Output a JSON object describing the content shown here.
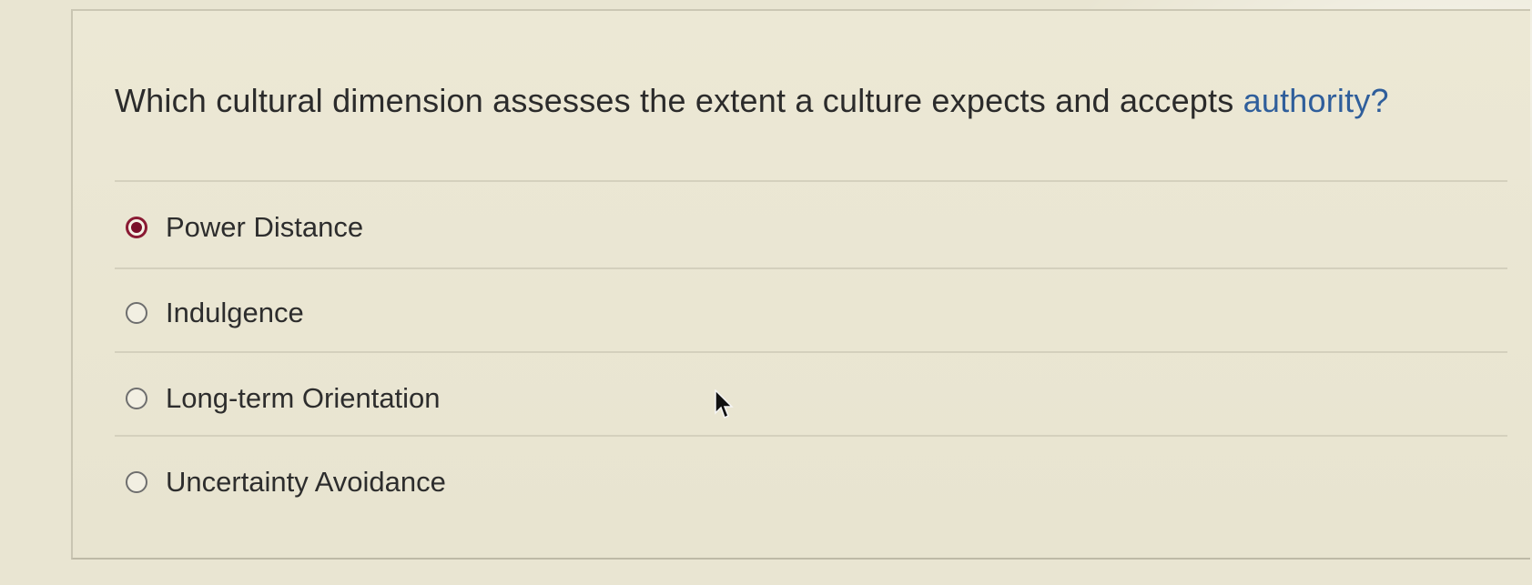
{
  "question": {
    "text_before": "Which cultural dimension assesses the extent a culture expects and accepts ",
    "text_link": "authority?"
  },
  "options": [
    {
      "label": "Power Distance",
      "selected": true
    },
    {
      "label": "Indulgence",
      "selected": false
    },
    {
      "label": "Long-term Orientation",
      "selected": false
    },
    {
      "label": "Uncertainty Avoidance",
      "selected": false
    }
  ],
  "colors": {
    "background": "#e9e5d2",
    "selected_radio": "#7a0f2a",
    "link": "#2f5e9b"
  },
  "icons": {
    "pointer": "mouse-pointer-icon"
  }
}
